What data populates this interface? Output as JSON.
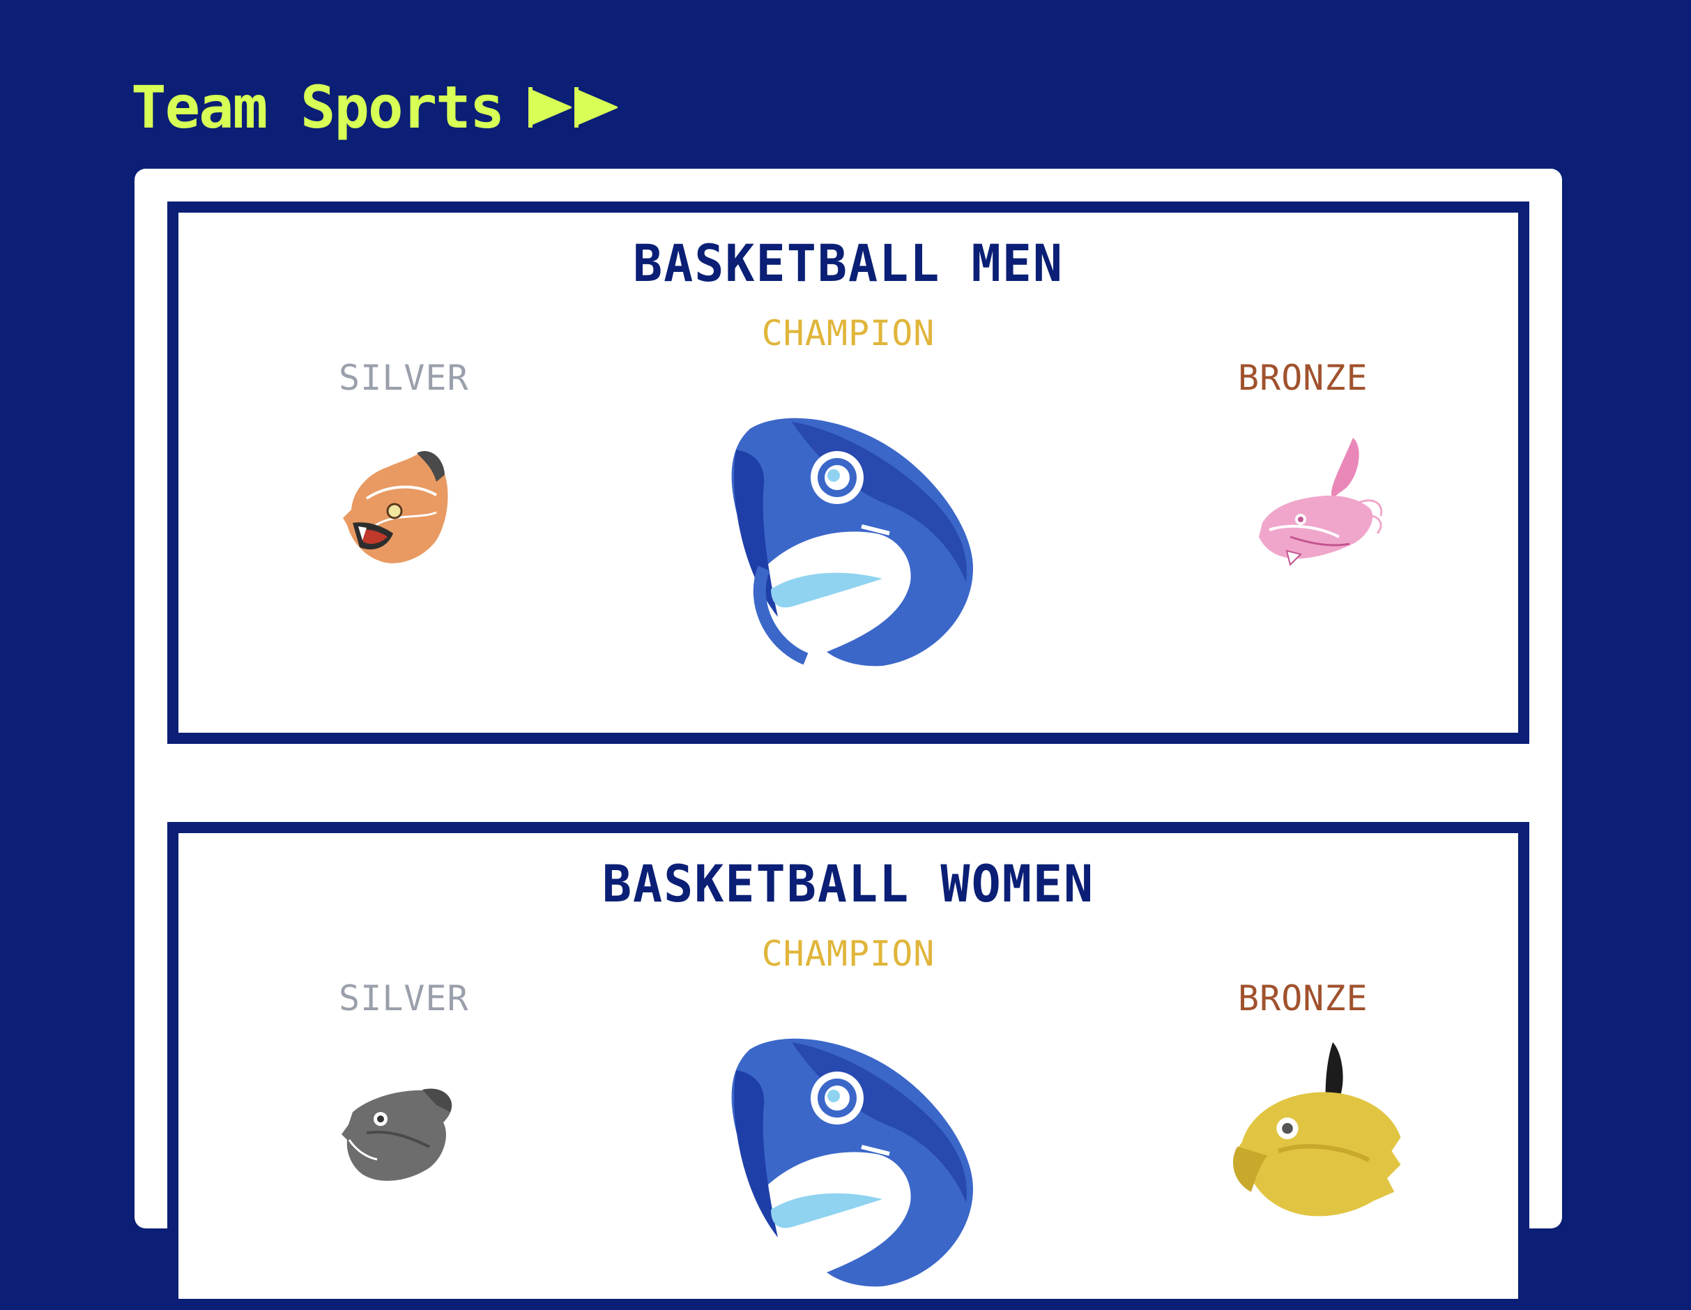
{
  "section": {
    "title": "Team Sports",
    "arrow_icon": "fast-forward-icon"
  },
  "colors": {
    "background": "#0a1f75",
    "accent": "#d8ff55",
    "champion": "#e0b53a",
    "silver": "#9aa0ab",
    "bronze": "#a0522d"
  },
  "cards": [
    {
      "title": "BASKETBALL MEN",
      "champion_label": "CHAMPION",
      "silver_label": "SILVER",
      "bronze_label": "BRONZE",
      "champion_mascot": "blue-shark-mascot-icon",
      "silver_mascot": "orange-tiger-mascot-icon",
      "bronze_mascot": "pink-dragon-mascot-icon"
    },
    {
      "title": "BASKETBALL WOMEN",
      "champion_label": "CHAMPION",
      "silver_label": "SILVER",
      "bronze_label": "BRONZE",
      "champion_mascot": "blue-shark-mascot-icon",
      "silver_mascot": "gray-panther-mascot-icon",
      "bronze_mascot": "yellow-eagle-mascot-icon"
    }
  ]
}
